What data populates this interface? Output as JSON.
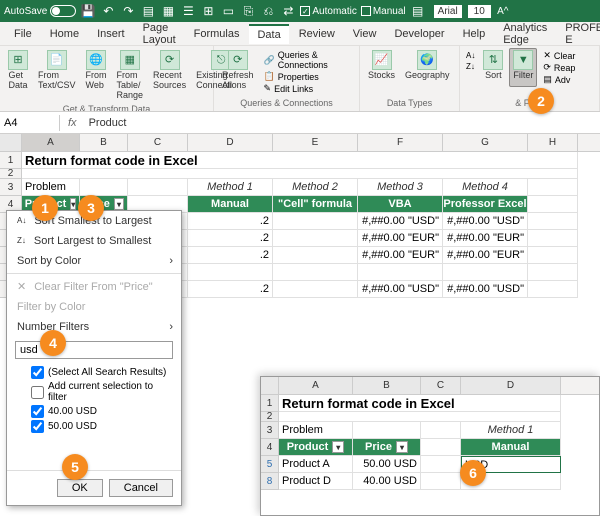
{
  "titlebar": {
    "autosave_label": "AutoSave",
    "autosave_state": "Off",
    "automatic_label": "Automatic",
    "manual_label": "Manual",
    "font_name": "Arial",
    "font_size": "10"
  },
  "menu": {
    "file": "File",
    "home": "Home",
    "insert": "Insert",
    "page_layout": "Page Layout",
    "formulas": "Formulas",
    "data": "Data",
    "review": "Review",
    "view": "View",
    "developer": "Developer",
    "help": "Help",
    "analytics": "Analytics Edge",
    "prof": "PROFESSOR E"
  },
  "ribbon": {
    "get_data": "Get\nData",
    "from_text": "From\nText/CSV",
    "from_web": "From\nWeb",
    "from_table": "From Table/\nRange",
    "recent": "Recent\nSources",
    "existing": "Existing\nConnections",
    "group1": "Get & Transform Data",
    "refresh": "Refresh\nAll",
    "queries": "Queries & Connections",
    "properties": "Properties",
    "edit_links": "Edit Links",
    "group2": "Queries & Connections",
    "stocks": "Stocks",
    "geography": "Geography",
    "group3": "Data Types",
    "sort": "Sort",
    "filter": "Filter",
    "clear": "Clear",
    "reapply": "Reap",
    "advanced": "Adv",
    "group4": "& Filter"
  },
  "formula_bar": {
    "name_box": "A4",
    "value": "Product"
  },
  "sheet": {
    "col_widths": {
      "A": 58,
      "B": 48,
      "C": 60,
      "D": 85,
      "E": 85,
      "F": 85,
      "G": 85,
      "H": 50
    },
    "title": "Return format code in Excel",
    "problem_label": "Problem",
    "method_labels": [
      "Method 1",
      "Method 2",
      "Method 3",
      "Method 4"
    ],
    "hdr": {
      "product": "Product",
      "price": "Price",
      "manual": "Manual",
      "cell": "\"Cell\" formula",
      "vba": "VBA",
      "prof": "Professor Excel"
    },
    "rows": [
      {
        "d": ".2",
        "e": "",
        "f": "#,##0.00 \"USD\"",
        "g": "#,##0.00 \"USD\""
      },
      {
        "d": ".2",
        "e": "",
        "f": "#,##0.00 \"EUR\"",
        "g": "#,##0.00 \"EUR\""
      },
      {
        "d": ".2",
        "e": "",
        "f": "#,##0.00 \"EUR\"",
        "g": "#,##0.00 \"EUR\""
      },
      {
        "d": "",
        "e": "",
        "f": "",
        "g": ""
      },
      {
        "d": ".2",
        "e": "",
        "f": "#,##0.00 \"USD\"",
        "g": "#,##0.00 \"USD\""
      }
    ]
  },
  "filter": {
    "sort_asc": "Sort Smallest to Largest",
    "sort_desc": "Sort Largest to Smallest",
    "sort_color": "Sort by Color",
    "clear": "Clear Filter From \"Price\"",
    "filter_color": "Filter by Color",
    "number_filters": "Number Filters",
    "search_value": "usd",
    "check1": "(Select All Search Results)",
    "check2": "Add current selection to filter",
    "check3": "40.00 USD",
    "check4": "50.00 USD",
    "ok": "OK",
    "cancel": "Cancel"
  },
  "inset": {
    "title": "Return format code in Excel",
    "problem": "Problem",
    "method1": "Method 1",
    "product": "Product",
    "price": "Price",
    "manual": "Manual",
    "rows": [
      {
        "n": "5",
        "a": "Product A",
        "b": "50.00 USD"
      },
      {
        "n": "8",
        "a": "Product D",
        "b": "40.00 USD"
      }
    ],
    "d5": "USD"
  },
  "bubbles": {
    "b1": "1",
    "b2": "2",
    "b3": "3",
    "b4": "4",
    "b5": "5",
    "b6": "6"
  }
}
